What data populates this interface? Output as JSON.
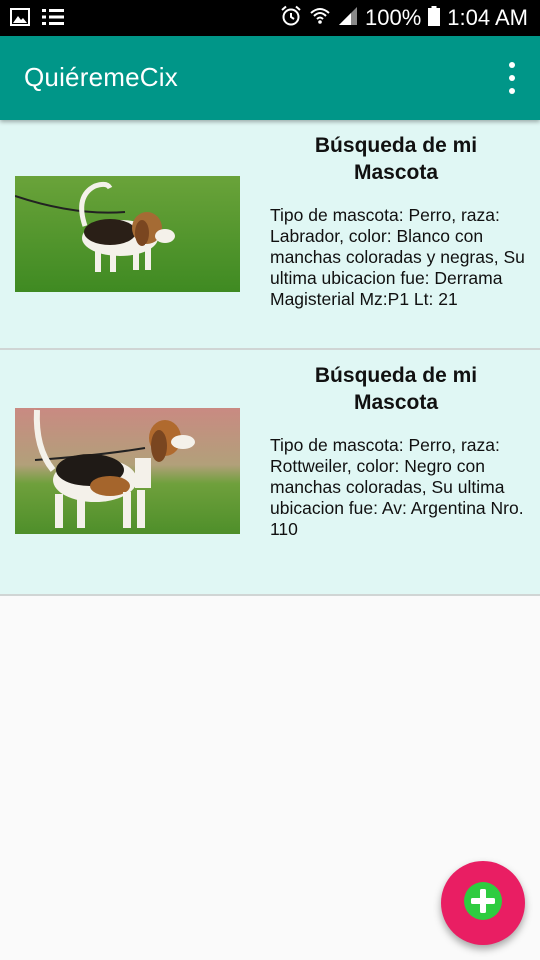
{
  "status_bar": {
    "battery": "100%",
    "time": "1:04 AM",
    "icons": [
      "gallery-icon",
      "list-icon",
      "alarm-icon",
      "wifi-icon",
      "signal-icon",
      "battery-icon"
    ]
  },
  "app_bar": {
    "title": "QuiéremeCix",
    "overflow_icon": "more-vert-icon"
  },
  "cards": [
    {
      "title": "Búsqueda de mi Mascota",
      "description": "Tipo de mascota: Perro, raza: Labrador, color: Blanco con manchas coloradas y negras, Su ultima ubicacion fue: Derrama Magisterial Mz:P1 Lt: 21"
    },
    {
      "title": "Búsqueda de mi Mascota",
      "description": "Tipo de mascota: Perro, raza: Rottweiler, color: Negro con manchas coloradas, Su ultima ubicacion fue: Av: Argentina Nro. 110"
    }
  ],
  "fab": {
    "icon": "add-circle-icon"
  },
  "colors": {
    "primary": "#009688",
    "card_background": "#e0f7f4",
    "fab": "#e91e63",
    "fab_icon": "#2ecc40"
  }
}
